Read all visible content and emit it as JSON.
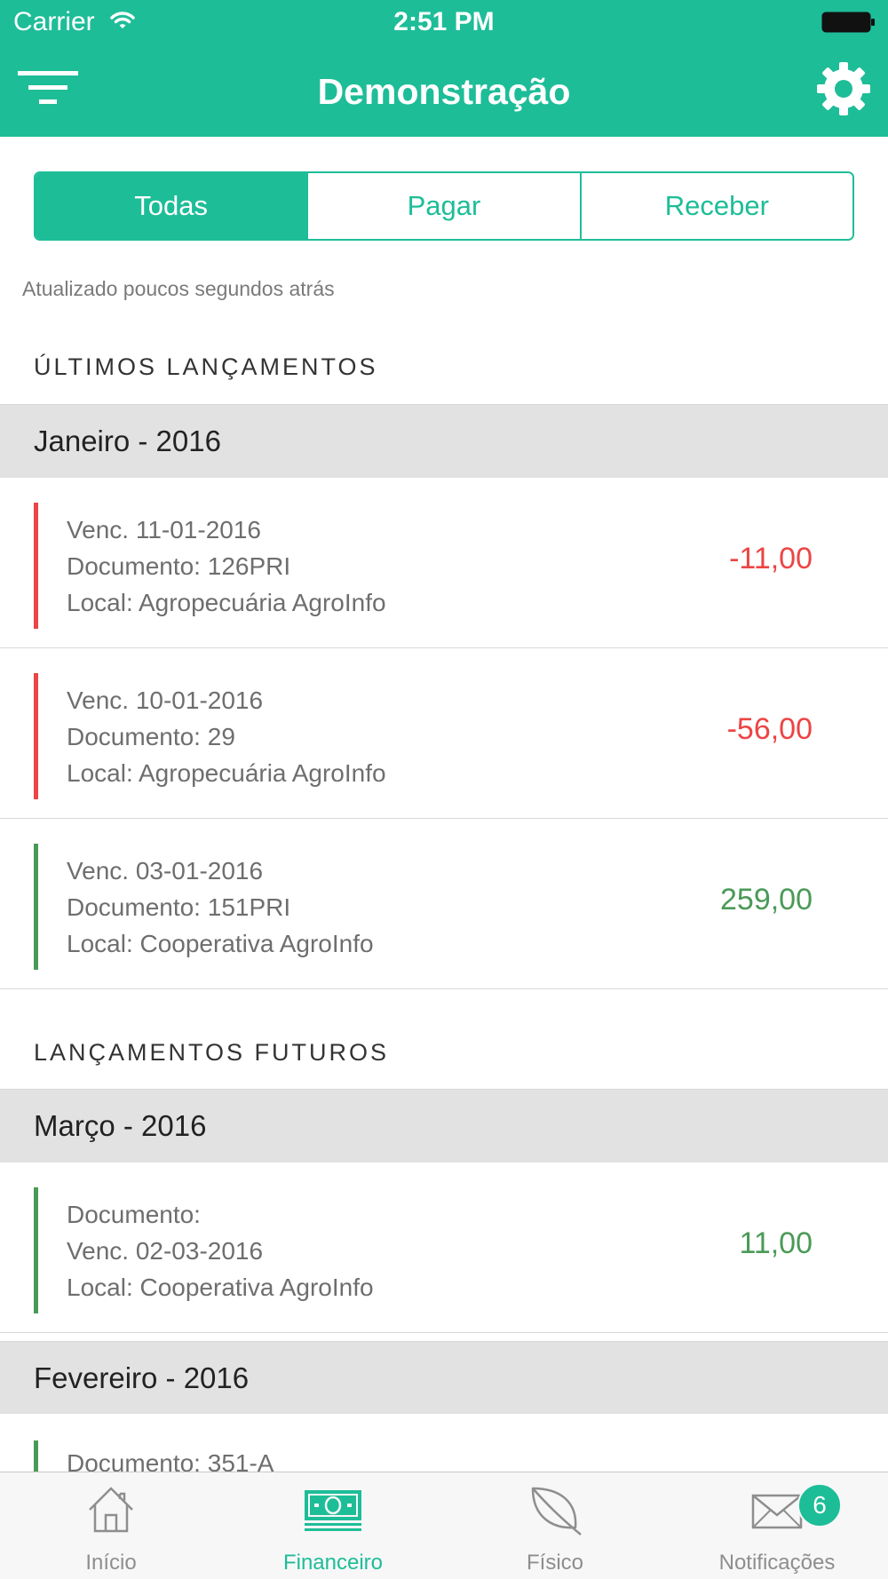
{
  "status_bar": {
    "carrier": "Carrier",
    "time": "2:51 PM"
  },
  "nav": {
    "title": "Demonstração",
    "left_icon": "filter-icon",
    "right_icon": "gear-icon"
  },
  "segments": [
    {
      "label": "Todas",
      "active": true
    },
    {
      "label": "Pagar",
      "active": false
    },
    {
      "label": "Receber",
      "active": false
    }
  ],
  "updated_text": "Atualizado poucos segundos atrás",
  "sections": {
    "recent_title": "ÚLTIMOS LANÇAMENTOS",
    "future_title": "LANÇAMENTOS FUTUROS"
  },
  "recent": {
    "month": "Janeiro - 2016",
    "entries": [
      {
        "line1": "Venc. 11-01-2016",
        "line2": "Documento: 126PRI",
        "line3": "Local: Agropecuária AgroInfo",
        "amount": "-11,00",
        "type": "debit"
      },
      {
        "line1": "Venc. 10-01-2016",
        "line2": "Documento: 29",
        "line3": "Local: Agropecuária AgroInfo",
        "amount": "-56,00",
        "type": "debit"
      },
      {
        "line1": "Venc. 03-01-2016",
        "line2": "Documento: 151PRI",
        "line3": "Local: Cooperativa AgroInfo",
        "amount": "259,00",
        "type": "credit"
      }
    ]
  },
  "future": {
    "month_1": "Março - 2016",
    "entry_1": {
      "line1": "Documento:",
      "line2": "Venc. 02-03-2016",
      "line3": "Local: Cooperativa AgroInfo",
      "amount": "11,00",
      "type": "credit"
    },
    "month_2": "Fevereiro - 2016",
    "partial_entry": "Documento: 351-A"
  },
  "colors": {
    "accent": "#1dbd98",
    "debit": "#ec4545",
    "credit": "#4a9a57"
  },
  "tabs": [
    {
      "label": "Início",
      "icon": "home-icon",
      "active": false
    },
    {
      "label": "Financeiro",
      "icon": "money-icon",
      "active": true
    },
    {
      "label": "Físico",
      "icon": "leaf-icon",
      "active": false
    },
    {
      "label": "Notificações",
      "icon": "mail-icon",
      "active": false,
      "badge": "6"
    }
  ]
}
